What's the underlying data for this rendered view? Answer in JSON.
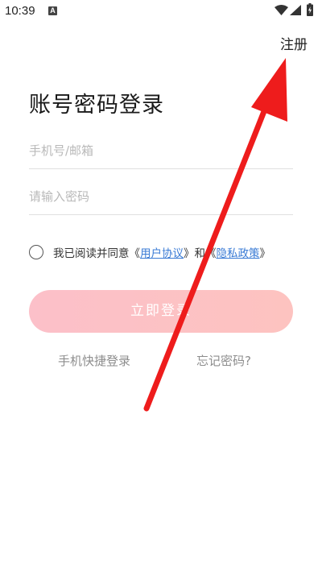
{
  "status_bar": {
    "time": "10:39",
    "notification_icon": "A",
    "icons": [
      "wifi-icon",
      "signal-icon",
      "battery-charging-icon"
    ]
  },
  "header": {
    "register_label": "注册"
  },
  "main": {
    "title": "账号密码登录",
    "account_input": {
      "value": "",
      "placeholder": "手机号/邮箱"
    },
    "password_input": {
      "value": "",
      "placeholder": "请输入密码"
    },
    "agreement": {
      "checked": false,
      "prefix": "我已阅读并同意",
      "open_bracket_1": "《",
      "user_agreement_label": "用户协议",
      "close_bracket_1": "》",
      "conjunction": "和",
      "open_bracket_2": "《",
      "privacy_policy_label": "隐私政策",
      "close_bracket_2": "》"
    },
    "login_button_label": "立即登录",
    "quick_login_label": "手机快捷登录",
    "forgot_password_label": "忘记密码?"
  },
  "colors": {
    "login_button_gradient_start": "#fcc0c9",
    "login_button_gradient_end": "#fdc3c0",
    "link": "#3a7bd5",
    "annotation_arrow": "#ee1c1c"
  }
}
